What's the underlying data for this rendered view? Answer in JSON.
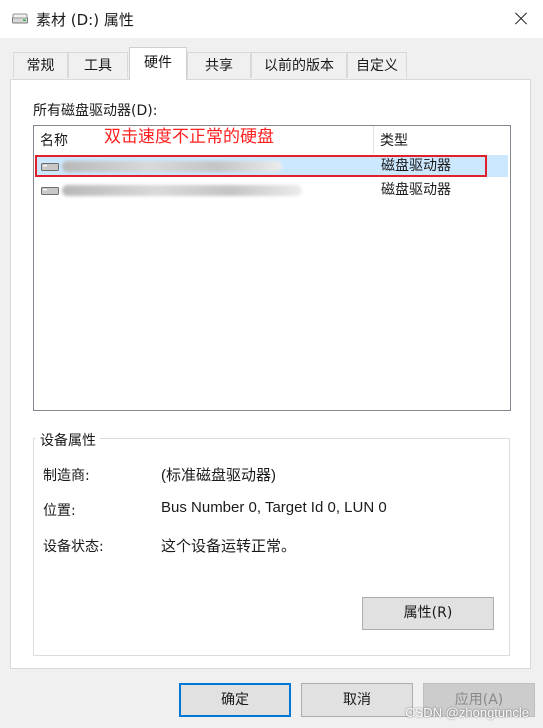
{
  "window": {
    "title": "素材 (D:) 属性"
  },
  "tabs": [
    {
      "label": "常规"
    },
    {
      "label": "工具"
    },
    {
      "label": "硬件",
      "active": true
    },
    {
      "label": "共享"
    },
    {
      "label": "以前的版本"
    },
    {
      "label": "自定义"
    }
  ],
  "disk_list": {
    "label": "所有磁盘驱动器(D):",
    "columns": {
      "name": "名称",
      "type": "类型"
    },
    "annotation": "双击速度不正常的硬盘",
    "rows": [
      {
        "type": "磁盘驱动器",
        "selected": true
      },
      {
        "type": "磁盘驱动器",
        "selected": false
      }
    ]
  },
  "device_properties": {
    "legend": "设备属性",
    "manufacturer_label": "制造商:",
    "manufacturer_value": "(标准磁盘驱动器)",
    "location_label": "位置:",
    "location_value": "Bus Number 0, Target Id 0, LUN 0",
    "status_label": "设备状态:",
    "status_value": "这个设备运转正常。",
    "properties_button": "属性(R)"
  },
  "buttons": {
    "ok": "确定",
    "cancel": "取消",
    "apply": "应用(A)"
  },
  "watermark": "CSDN @zhongtuncle",
  "colors": {
    "accent": "#0078d7",
    "selection": "#cce8ff",
    "annotation_red": "#e0202a"
  }
}
